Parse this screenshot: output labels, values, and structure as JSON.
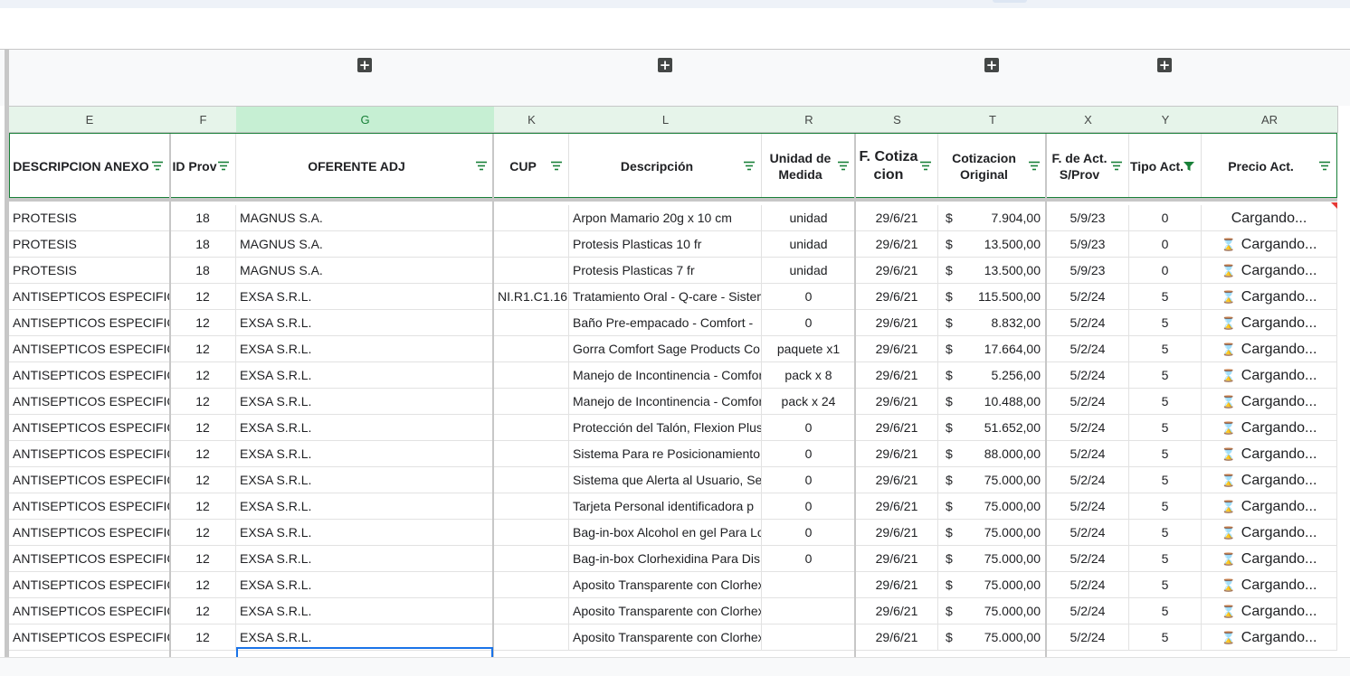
{
  "columns": [
    {
      "letter": "E",
      "header": "DESCRIPCION ANEXO"
    },
    {
      "letter": "F",
      "header": "ID Prov"
    },
    {
      "letter": "G",
      "header": "OFERENTE ADJ"
    },
    {
      "letter": "K",
      "header": "CUP"
    },
    {
      "letter": "L",
      "header": "Descripción"
    },
    {
      "letter": "R",
      "header": "Unidad de Medida"
    },
    {
      "letter": "S",
      "header": "F. Cotiza cion"
    },
    {
      "letter": "T",
      "header": "Cotizacion Original"
    },
    {
      "letter": "X",
      "header": "F. de Act. S/Prov"
    },
    {
      "letter": "Y",
      "header": "Tipo Act."
    },
    {
      "letter": "AR",
      "header": "Precio Act."
    }
  ],
  "group_button_label": "+",
  "currency_symbol": "$",
  "rows": [
    {
      "e": "PROTESIS",
      "f": "18",
      "g": "MAGNUS S.A.",
      "k": "",
      "l": "Arpon Mamario 20g x 10 cm",
      "r": "unidad",
      "s": "29/6/21",
      "t": "7.904,00",
      "x": "5/9/23",
      "y": "0",
      "ar": "Cargando...",
      "icon": false
    },
    {
      "e": "PROTESIS",
      "f": "18",
      "g": "MAGNUS S.A.",
      "k": "",
      "l": "Protesis Plasticas 10 fr",
      "r": "unidad",
      "s": "29/6/21",
      "t": "13.500,00",
      "x": "5/9/23",
      "y": "0",
      "ar": "Cargando...",
      "icon": true
    },
    {
      "e": "PROTESIS",
      "f": "18",
      "g": "MAGNUS S.A.",
      "k": "",
      "l": "Protesis Plasticas 7 fr",
      "r": "unidad",
      "s": "29/6/21",
      "t": "13.500,00",
      "x": "5/9/23",
      "y": "0",
      "ar": "Cargando...",
      "icon": true
    },
    {
      "e": "ANTISEPTICOS ESPECIFICOS",
      "f": "12",
      "g": "EXSA S.R.L.",
      "k": "NI.R1.C1.16",
      "l": "Tratamiento Oral - Q-care - Sistema",
      "r": "0",
      "s": "29/6/21",
      "t": "115.500,00",
      "x": "5/2/24",
      "y": "5",
      "ar": "Cargando...",
      "icon": true
    },
    {
      "e": "ANTISEPTICOS ESPECIFICOS",
      "f": "12",
      "g": "EXSA S.R.L.",
      "k": "",
      "l": "Baño Pre-empacado - Comfort -",
      "r": "0",
      "s": "29/6/21",
      "t": "8.832,00",
      "x": "5/2/24",
      "y": "5",
      "ar": "Cargando...",
      "icon": true
    },
    {
      "e": "ANTISEPTICOS ESPECIFICOS",
      "f": "12",
      "g": "EXSA S.R.L.",
      "k": "",
      "l": "Gorra Comfort Sage Products Co",
      "r": "paquete x1",
      "s": "29/6/21",
      "t": "17.664,00",
      "x": "5/2/24",
      "y": "5",
      "ar": "Cargando...",
      "icon": true
    },
    {
      "e": "ANTISEPTICOS ESPECIFICOS",
      "f": "12",
      "g": "EXSA S.R.L.",
      "k": "",
      "l": "Manejo de Incontinencia - Comfort",
      "r": "pack x 8",
      "s": "29/6/21",
      "t": "5.256,00",
      "x": "5/2/24",
      "y": "5",
      "ar": "Cargando...",
      "icon": true
    },
    {
      "e": "ANTISEPTICOS ESPECIFICOS",
      "f": "12",
      "g": "EXSA S.R.L.",
      "k": "",
      "l": "Manejo de Incontinencia - Comfort",
      "r": "pack x 24",
      "s": "29/6/21",
      "t": "10.488,00",
      "x": "5/2/24",
      "y": "5",
      "ar": "Cargando...",
      "icon": true
    },
    {
      "e": "ANTISEPTICOS ESPECIFICOS",
      "f": "12",
      "g": "EXSA S.R.L.",
      "k": "",
      "l": "Protección del Talón, Flexion Plus",
      "r": "0",
      "s": "29/6/21",
      "t": "51.652,00",
      "x": "5/2/24",
      "y": "5",
      "ar": "Cargando...",
      "icon": true
    },
    {
      "e": "ANTISEPTICOS ESPECIFICOS",
      "f": "12",
      "g": "EXSA S.R.L.",
      "k": "",
      "l": "Sistema Para re Posicionamiento",
      "r": "0",
      "s": "29/6/21",
      "t": "88.000,00",
      "x": "5/2/24",
      "y": "5",
      "ar": "Cargando...",
      "icon": true
    },
    {
      "e": "ANTISEPTICOS ESPECIFICOS",
      "f": "12",
      "g": "EXSA S.R.L.",
      "k": "",
      "l": "Sistema que Alerta al Usuario, Se",
      "r": "0",
      "s": "29/6/21",
      "t": "75.000,00",
      "x": "5/2/24",
      "y": "5",
      "ar": "Cargando...",
      "icon": true
    },
    {
      "e": "ANTISEPTICOS ESPECIFICOS",
      "f": "12",
      "g": "EXSA S.R.L.",
      "k": "",
      "l": "Tarjeta Personal identificadora p",
      "r": "0",
      "s": "29/6/21",
      "t": "75.000,00",
      "x": "5/2/24",
      "y": "5",
      "ar": "Cargando...",
      "icon": true
    },
    {
      "e": "ANTISEPTICOS ESPECIFICOS",
      "f": "12",
      "g": "EXSA S.R.L.",
      "k": "",
      "l": "Bag-in-box Alcohol en gel Para Lo",
      "r": "0",
      "s": "29/6/21",
      "t": "75.000,00",
      "x": "5/2/24",
      "y": "5",
      "ar": "Cargando...",
      "icon": true
    },
    {
      "e": "ANTISEPTICOS ESPECIFICOS",
      "f": "12",
      "g": "EXSA S.R.L.",
      "k": "",
      "l": "Bag-in-box Clorhexidina Para Dis",
      "r": "0",
      "s": "29/6/21",
      "t": "75.000,00",
      "x": "5/2/24",
      "y": "5",
      "ar": "Cargando...",
      "icon": true
    },
    {
      "e": "ANTISEPTICOS ESPECIFICOS",
      "f": "12",
      "g": "EXSA S.R.L.",
      "k": "",
      "l": "Aposito Transparente con Clorhex",
      "r": "",
      "s": "29/6/21",
      "t": "75.000,00",
      "x": "5/2/24",
      "y": "5",
      "ar": "Cargando...",
      "icon": true
    },
    {
      "e": "ANTISEPTICOS ESPECIFICOS",
      "f": "12",
      "g": "EXSA S.R.L.",
      "k": "",
      "l": "Aposito Transparente con Clorhex",
      "r": "",
      "s": "29/6/21",
      "t": "75.000,00",
      "x": "5/2/24",
      "y": "5",
      "ar": "Cargando...",
      "icon": true
    },
    {
      "e": "ANTISEPTICOS ESPECIFICOS",
      "f": "12",
      "g": "EXSA S.R.L.",
      "k": "",
      "l": "Aposito Transparente con Clorhex",
      "r": "",
      "s": "29/6/21",
      "t": "75.000,00",
      "x": "5/2/24",
      "y": "5",
      "ar": "Cargando...",
      "icon": true
    }
  ],
  "colors": {
    "accent": "#188038",
    "header_bg": "#e6f4ea",
    "selected_col_bg": "#c6efd3",
    "selection": "#1a73e8",
    "loading_icon": "#f4a300"
  },
  "icons": {
    "filter": "filter-icon",
    "active_filter": "filter-active-icon",
    "loading": "hourglass-icon",
    "group": "plus-icon"
  }
}
